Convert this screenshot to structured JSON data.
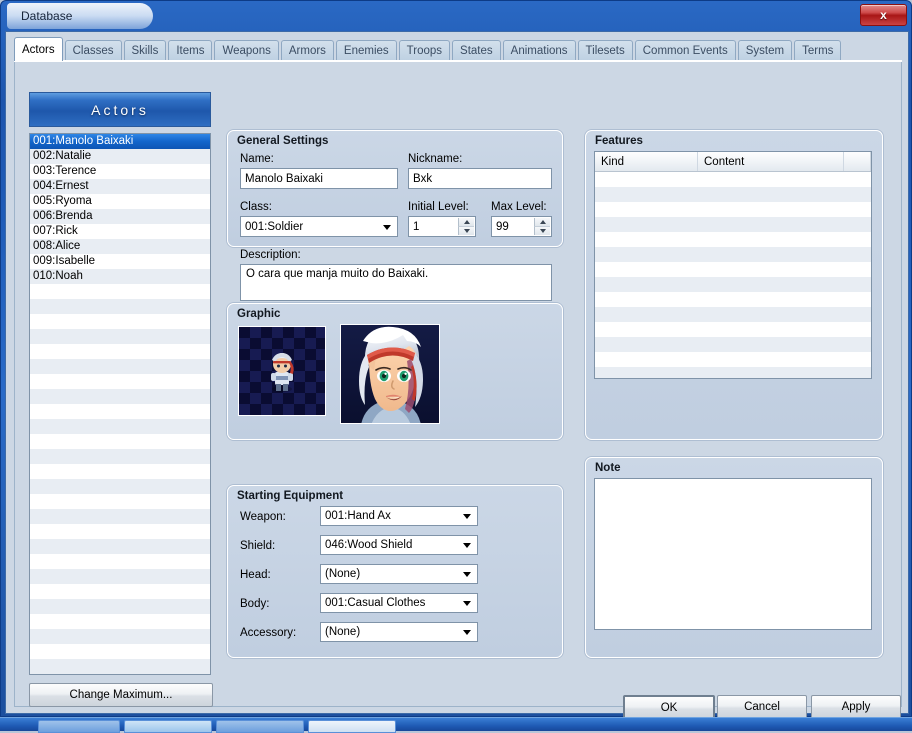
{
  "window": {
    "title": "Database",
    "close_label": "x"
  },
  "tabs": [
    {
      "label": "Actors",
      "active": true
    },
    {
      "label": "Classes",
      "active": false
    },
    {
      "label": "Skills",
      "active": false
    },
    {
      "label": "Items",
      "active": false
    },
    {
      "label": "Weapons",
      "active": false
    },
    {
      "label": "Armors",
      "active": false
    },
    {
      "label": "Enemies",
      "active": false
    },
    {
      "label": "Troops",
      "active": false
    },
    {
      "label": "States",
      "active": false
    },
    {
      "label": "Animations",
      "active": false
    },
    {
      "label": "Tilesets",
      "active": false
    },
    {
      "label": "Common Events",
      "active": false
    },
    {
      "label": "System",
      "active": false
    },
    {
      "label": "Terms",
      "active": false
    }
  ],
  "actors_panel": {
    "header": "Actors",
    "items": [
      "001:Manolo Baixaki",
      "002:Natalie",
      "003:Terence",
      "004:Ernest",
      "005:Ryoma",
      "006:Brenda",
      "007:Rick",
      "008:Alice",
      "009:Isabelle",
      "010:Noah"
    ],
    "selected_index": 0,
    "total_rows": 36,
    "change_maximum_label": "Change Maximum..."
  },
  "general_settings": {
    "title": "General Settings",
    "name_label": "Name:",
    "name_value": "Manolo Baixaki",
    "nickname_label": "Nickname:",
    "nickname_value": "Bxk",
    "class_label": "Class:",
    "class_value": "001:Soldier",
    "initial_level_label": "Initial Level:",
    "initial_level_value": "1",
    "max_level_label": "Max Level:",
    "max_level_value": "99",
    "description_label": "Description:",
    "description_value": "O cara que manja muito do Baixaki."
  },
  "graphic": {
    "title": "Graphic",
    "character_sprite_name": "character-sprite-thumbnail",
    "face_image_name": "face-portrait-thumbnail"
  },
  "starting_equipment": {
    "title": "Starting Equipment",
    "rows": [
      {
        "label": "Weapon:",
        "value": "001:Hand Ax"
      },
      {
        "label": "Shield:",
        "value": "046:Wood Shield"
      },
      {
        "label": "Head:",
        "value": "(None)"
      },
      {
        "label": "Body:",
        "value": "001:Casual Clothes"
      },
      {
        "label": "Accessory:",
        "value": "(None)"
      }
    ]
  },
  "features": {
    "title": "Features",
    "columns": [
      "Kind",
      "Content"
    ],
    "rows": [],
    "empty_row_count": 15
  },
  "note": {
    "title": "Note",
    "value": "",
    "placeholder": ""
  },
  "footer": {
    "ok_label": "OK",
    "cancel_label": "Cancel",
    "apply_label": "Apply"
  },
  "colors": {
    "titlebar_blue": "#1f5cb8",
    "accent_selection": "#1366cc",
    "panel_bg": "#ccd7e4",
    "group_bg": "#c6d3e3",
    "close_red": "#a81616"
  }
}
